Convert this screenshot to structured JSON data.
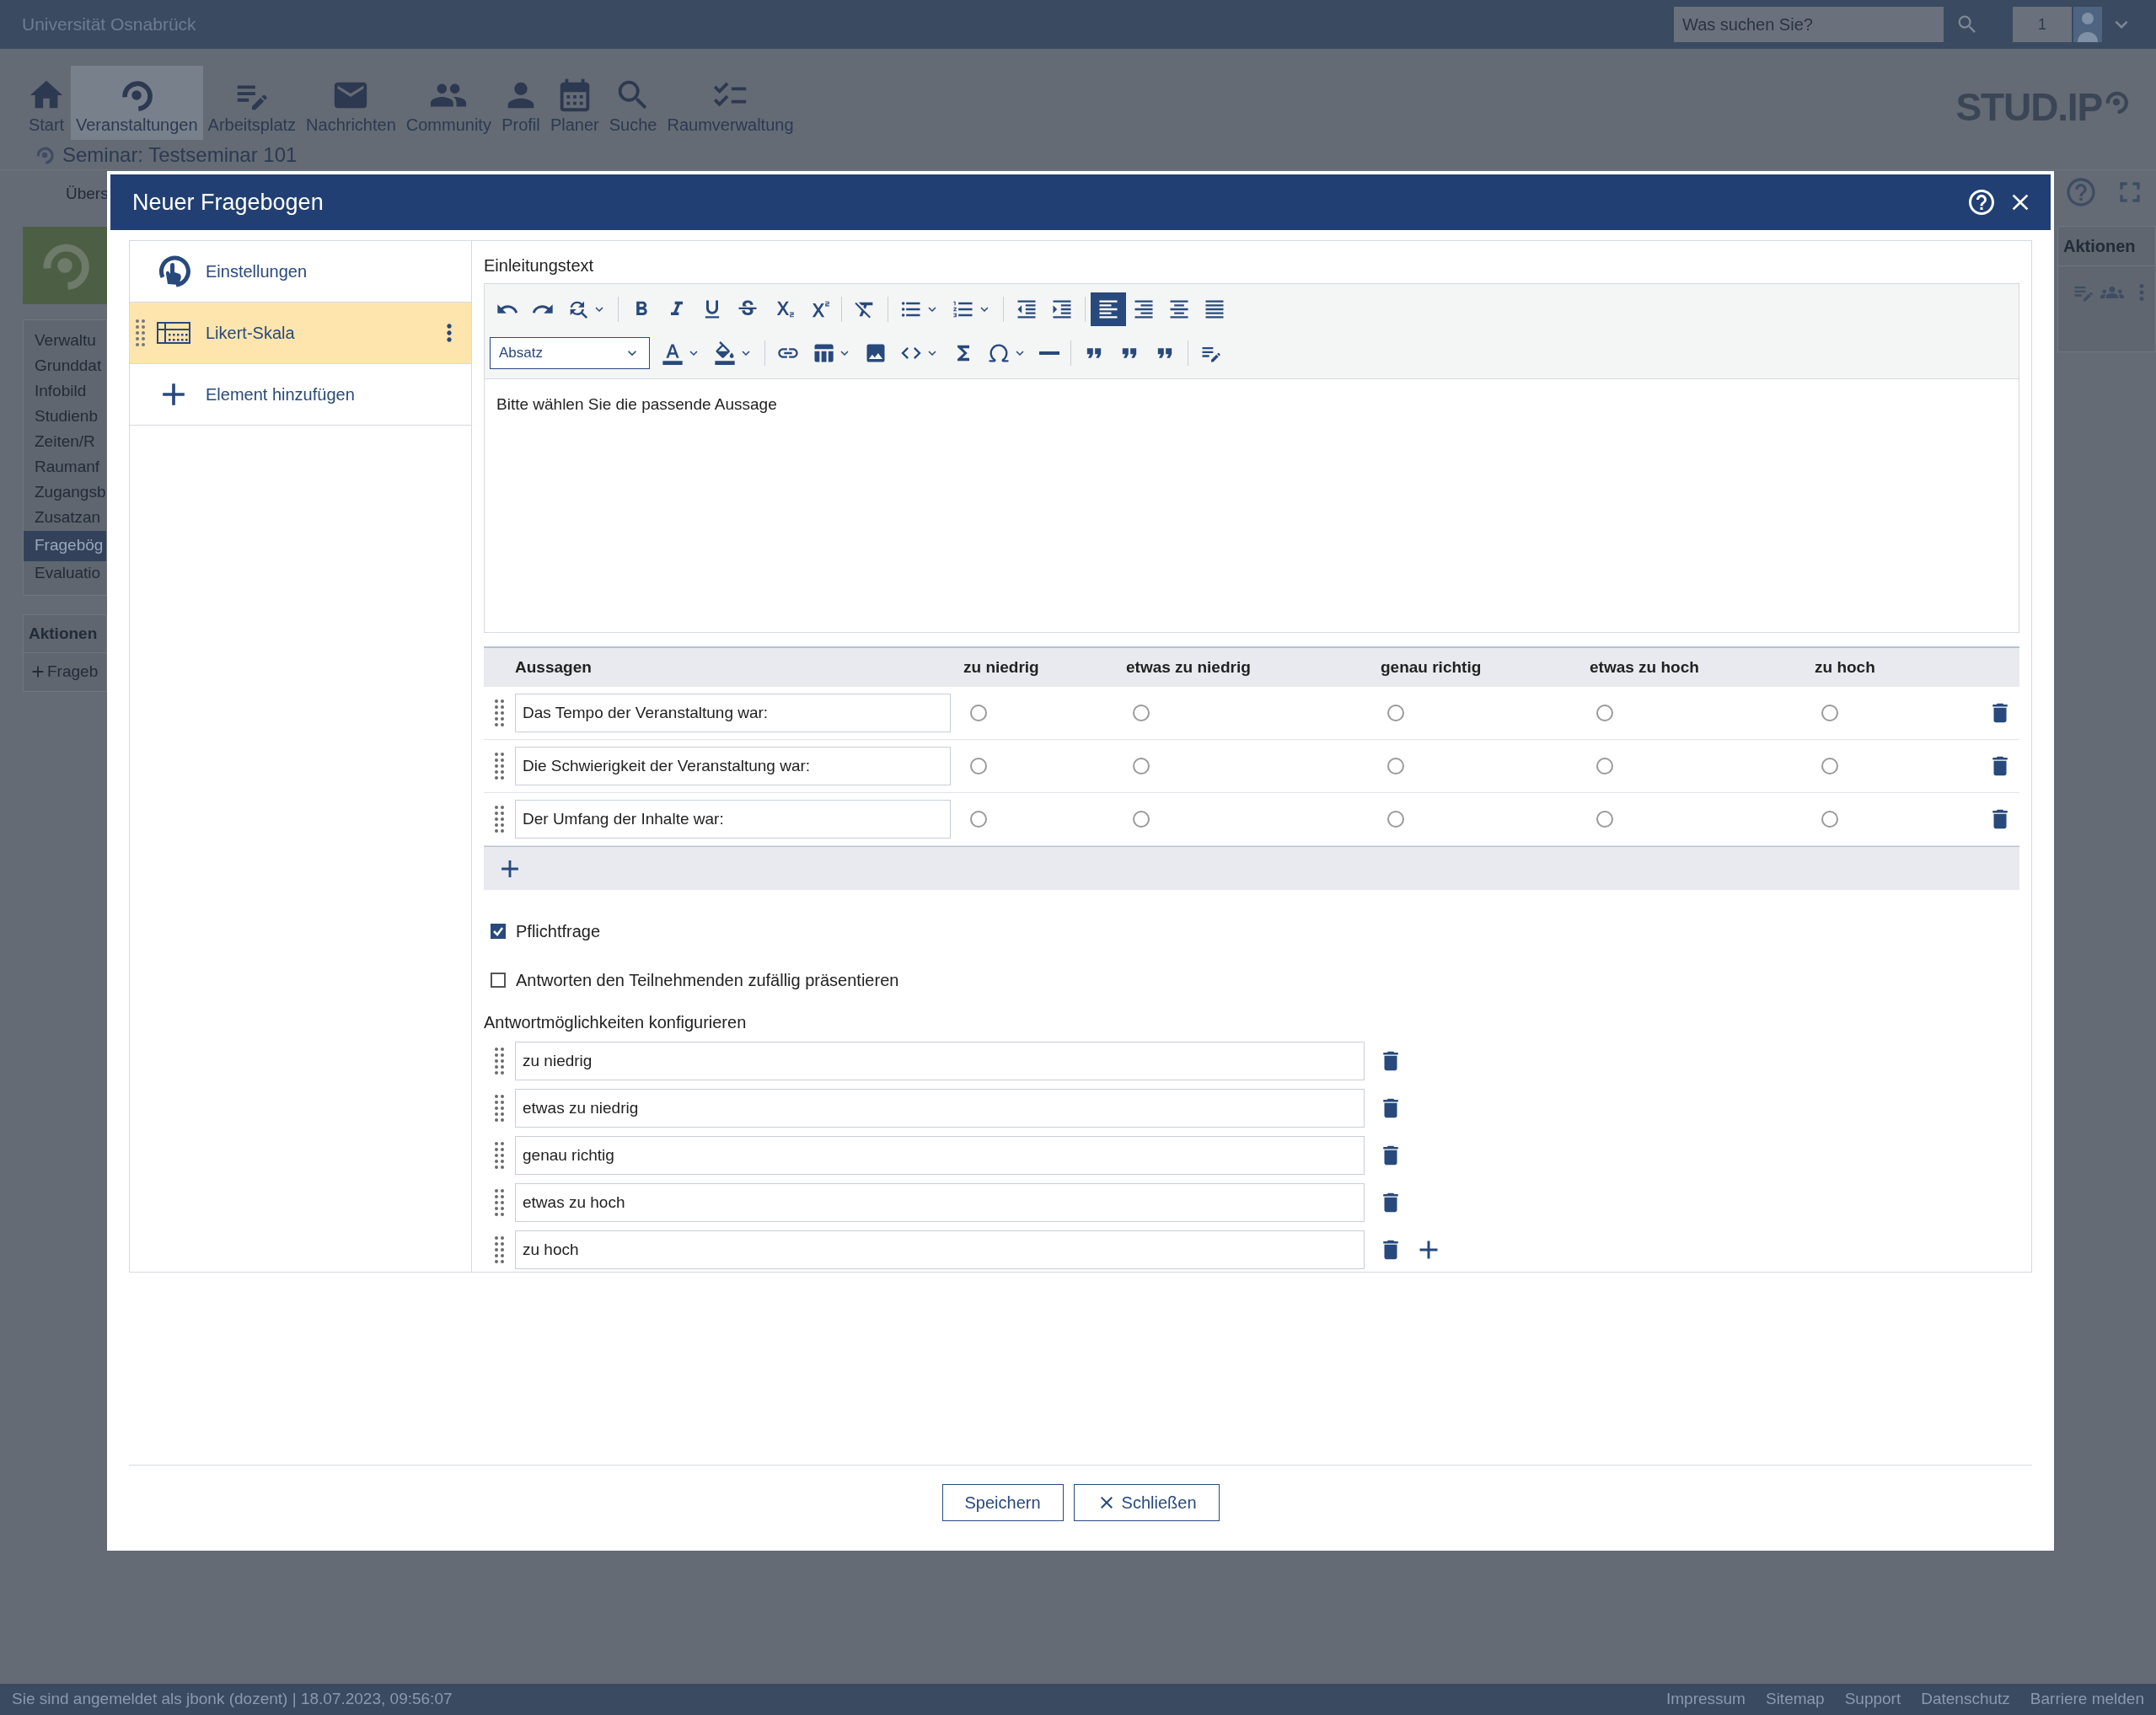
{
  "header": {
    "site_title": "Universität Osnabrück",
    "search": {
      "placeholder": "Was suchen Sie?"
    },
    "notification_count": "1"
  },
  "nav": [
    {
      "label": "Start",
      "selected": false
    },
    {
      "label": "Veranstaltungen",
      "selected": true
    },
    {
      "label": "Arbeitsplatz",
      "selected": false
    },
    {
      "label": "Nachrichten",
      "selected": false
    },
    {
      "label": "Community",
      "selected": false
    },
    {
      "label": "Profil",
      "selected": false
    },
    {
      "label": "Planer",
      "selected": false
    },
    {
      "label": "Suche",
      "selected": false
    },
    {
      "label": "Raumverwaltung",
      "selected": false
    }
  ],
  "logo": "STUD.IP",
  "course": {
    "title": "Seminar: Testseminar 101",
    "tab": "Übers"
  },
  "sidebar": {
    "items": [
      {
        "label": "Verwaltu",
        "selected": false
      },
      {
        "label": "Grunddat",
        "selected": false
      },
      {
        "label": "Infobild",
        "selected": false
      },
      {
        "label": "Studienb",
        "selected": false
      },
      {
        "label": "Zeiten/R",
        "selected": false
      },
      {
        "label": "Raumanf",
        "selected": false
      },
      {
        "label": "Zugangsb",
        "selected": false
      },
      {
        "label": "Zusatzan",
        "selected": false
      },
      {
        "label": "Fragebög",
        "selected": true
      },
      {
        "label": "Evaluatio",
        "selected": false
      }
    ],
    "actions_title": "Aktionen",
    "actions": [
      "Frageb"
    ]
  },
  "right_sidebar": {
    "title": "Aktionen"
  },
  "modal": {
    "title": "Neuer Fragebogen",
    "elements": [
      {
        "label": "Einstellungen",
        "kind": "settings",
        "selected": false
      },
      {
        "label": "Likert-Skala",
        "kind": "likert",
        "selected": true
      },
      {
        "label": "Element hinzufügen",
        "kind": "add",
        "selected": false
      }
    ],
    "editor": {
      "label": "Einleitungstext",
      "format": "Absatz",
      "content": "Bitte wählen Sie die passende Aussage",
      "alignment": [
        {
          "selected": true
        },
        {
          "selected": false
        },
        {
          "selected": false
        },
        {
          "selected": false
        }
      ]
    },
    "likert": {
      "columns": [
        "Aussagen",
        "zu niedrig",
        "etwas zu niedrig",
        "genau richtig",
        "etwas zu hoch",
        "zu hoch"
      ],
      "rows": [
        {
          "statement": "Das Tempo der Veranstaltung war:",
          "choices": [
            {
              "selected": false
            },
            {
              "selected": false
            },
            {
              "selected": false
            },
            {
              "selected": false
            },
            {
              "selected": false
            }
          ]
        },
        {
          "statement": "Die Schwierigkeit der Veranstaltung war:",
          "choices": [
            {
              "selected": false
            },
            {
              "selected": false
            },
            {
              "selected": false
            },
            {
              "selected": false
            },
            {
              "selected": false
            }
          ]
        },
        {
          "statement": "Der Umfang der Inhalte war:",
          "choices": [
            {
              "selected": false
            },
            {
              "selected": false
            },
            {
              "selected": false
            },
            {
              "selected": false
            },
            {
              "selected": false
            }
          ]
        }
      ]
    },
    "options": [
      {
        "label": "Pflichtfrage",
        "checked": true
      },
      {
        "label": "Antworten den Teilnehmenden zufällig präsentieren",
        "checked": false
      }
    ],
    "answers_label": "Antwortmöglichkeiten konfigurieren",
    "answers": [
      "zu niedrig",
      "etwas zu niedrig",
      "genau richtig",
      "etwas zu hoch",
      "zu hoch"
    ],
    "buttons": [
      {
        "label": "Speichern",
        "kind": "save"
      },
      {
        "label": "Schließen",
        "kind": "close"
      }
    ]
  },
  "footer": {
    "text": "Sie sind angemeldet als jbonk (dozent) | 18.07.2023, 09:56:07",
    "links": [
      "Impressum",
      "Sitemap",
      "Support",
      "Datenschutz",
      "Barriere melden"
    ]
  }
}
